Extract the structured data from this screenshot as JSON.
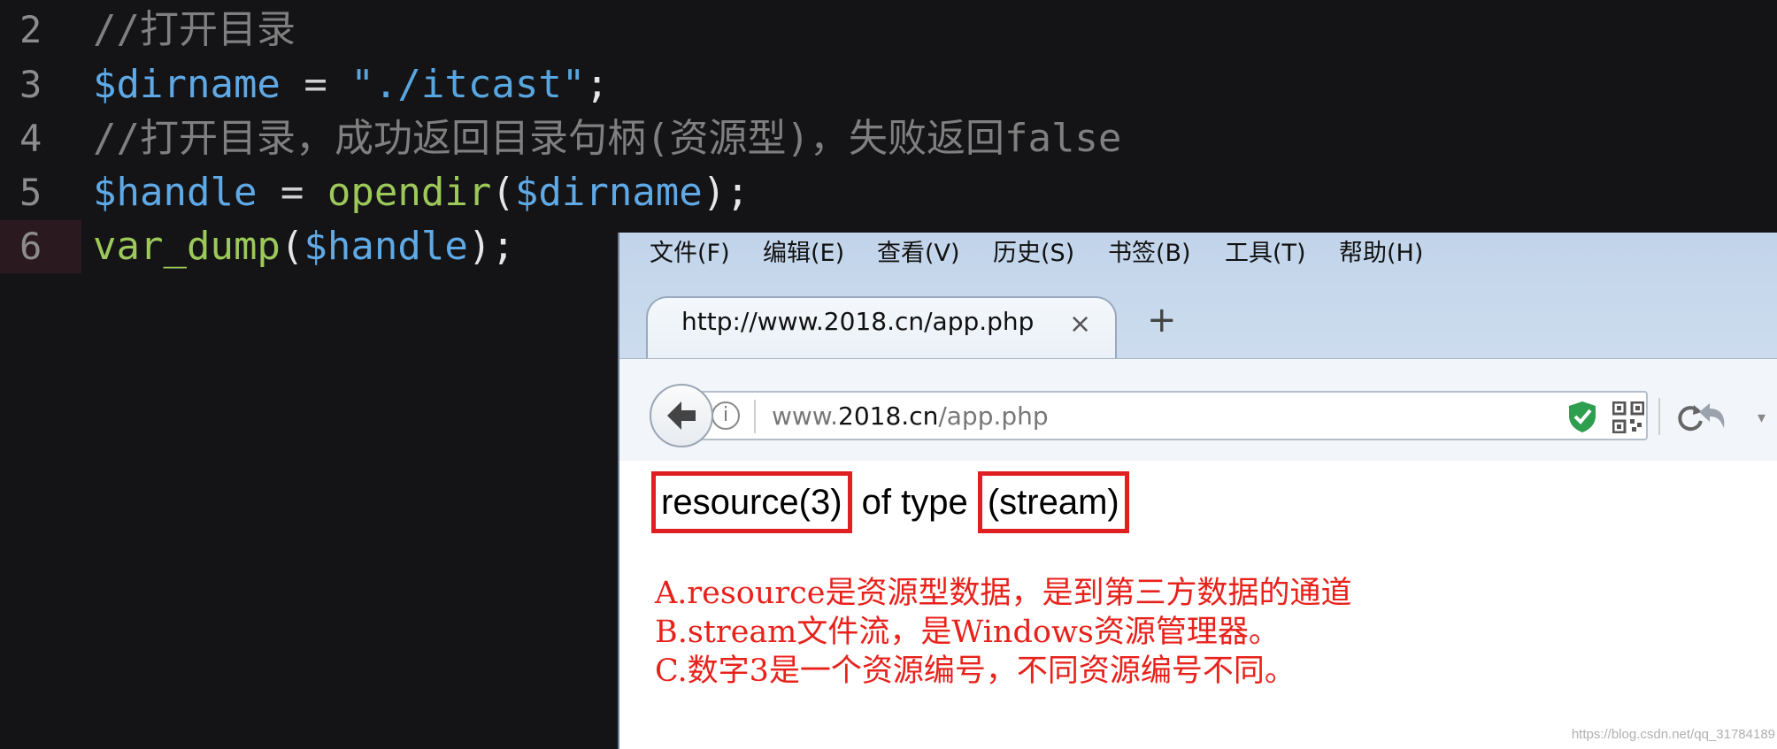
{
  "editor": {
    "lines": [
      {
        "num": "2",
        "tokens": [
          {
            "t": "//打开目录",
            "k": "comment"
          }
        ]
      },
      {
        "num": "3",
        "tokens": [
          {
            "t": "$dirname",
            "k": "var"
          },
          {
            "t": " = ",
            "k": "op"
          },
          {
            "t": "\"./itcast\"",
            "k": "str"
          },
          {
            "t": ";",
            "k": "punc"
          }
        ]
      },
      {
        "num": "4",
        "tokens": [
          {
            "t": "//打开目录，成功返回目录句柄(资源型)，失败返回false",
            "k": "comment"
          }
        ]
      },
      {
        "num": "5",
        "tokens": [
          {
            "t": "$handle",
            "k": "var"
          },
          {
            "t": " = ",
            "k": "op"
          },
          {
            "t": "opendir",
            "k": "fn"
          },
          {
            "t": "(",
            "k": "punc"
          },
          {
            "t": "$dirname",
            "k": "var"
          },
          {
            "t": ");",
            "k": "punc"
          }
        ]
      },
      {
        "num": "6",
        "tokens": [
          {
            "t": "var_dump",
            "k": "fn"
          },
          {
            "t": "(",
            "k": "punc"
          },
          {
            "t": "$handle",
            "k": "var"
          },
          {
            "t": ");",
            "k": "punc"
          }
        ],
        "active": true
      }
    ]
  },
  "browser": {
    "menu": [
      "文件(F)",
      "编辑(E)",
      "查看(V)",
      "历史(S)",
      "书签(B)",
      "工具(T)",
      "帮助(H)"
    ],
    "tab_title": "http://www.2018.cn/app.php",
    "tab_close": "×",
    "new_tab": "+",
    "url_prefix": "www.",
    "url_host": "2018.cn",
    "url_path": "/app.php",
    "info_glyph": "i",
    "output": {
      "part1": "resource(3)",
      "middle": " of type ",
      "part2": "(stream)"
    },
    "notes": [
      "A.resource是资源型数据，是到第三方数据的通道",
      "B.stream文件流，是Windows资源管理器。",
      "C.数字3是一个资源编号，不同资源编号不同。"
    ]
  },
  "watermark": "https://blog.csdn.net/qq_31784189",
  "colors": {
    "editor_bg": "#141416",
    "annotation_red": "#e8211b",
    "box_red": "#e02020"
  }
}
